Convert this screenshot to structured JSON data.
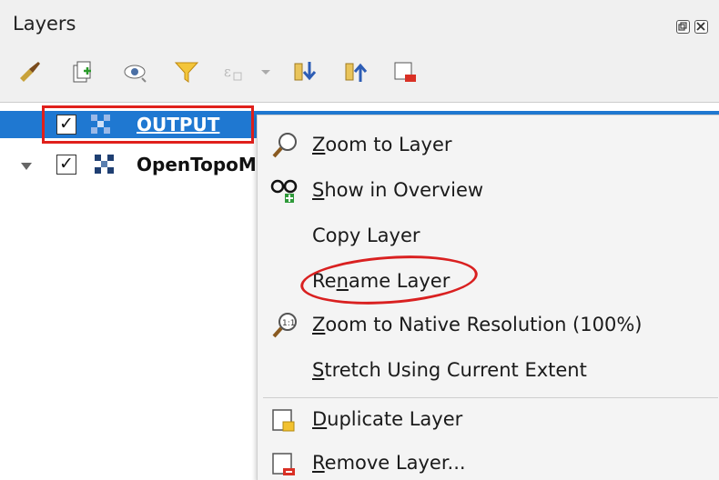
{
  "panel": {
    "title": "Layers",
    "title_buttons": [
      "float-icon",
      "close-icon"
    ]
  },
  "toolbar": {
    "icons": [
      "style-manager-icon",
      "add-group-icon",
      "visibility-icon",
      "filter-icon",
      "expression-filter-icon",
      "expand-all-icon",
      "collapse-all-icon",
      "remove-layer-icon"
    ]
  },
  "layers": [
    {
      "name": "OUTPUT",
      "checked": "✓",
      "selected": true
    },
    {
      "name": "OpenTopoM",
      "checked": "✓",
      "selected": false
    }
  ],
  "context_menu": {
    "items": [
      {
        "label_pre": "",
        "label_u": "Z",
        "label_post": "oom to Layer",
        "icon": "zoom-icon"
      },
      {
        "label_pre": "",
        "label_u": "S",
        "label_post": "how in Overview",
        "icon": "overview-icon"
      },
      {
        "label_pre": "Copy Layer",
        "label_u": "",
        "label_post": "",
        "icon": ""
      },
      {
        "label_pre": "Re",
        "label_u": "n",
        "label_post": "ame Layer",
        "icon": ""
      },
      {
        "label_pre": "",
        "label_u": "Z",
        "label_post": "oom to Native Resolution (100%)",
        "icon": "native-resolution-icon"
      },
      {
        "label_pre": "",
        "label_u": "S",
        "label_post": "tretch Using Current Extent",
        "icon": ""
      },
      {
        "label_pre": "",
        "label_u": "D",
        "label_post": "uplicate Layer",
        "icon": "duplicate-layer-icon"
      },
      {
        "label_pre": "",
        "label_u": "R",
        "label_post": "emove Layer...",
        "icon": "remove-layer-icon"
      }
    ]
  },
  "colors": {
    "selection": "#1f78d1",
    "highlight_red": "#e0201b"
  }
}
